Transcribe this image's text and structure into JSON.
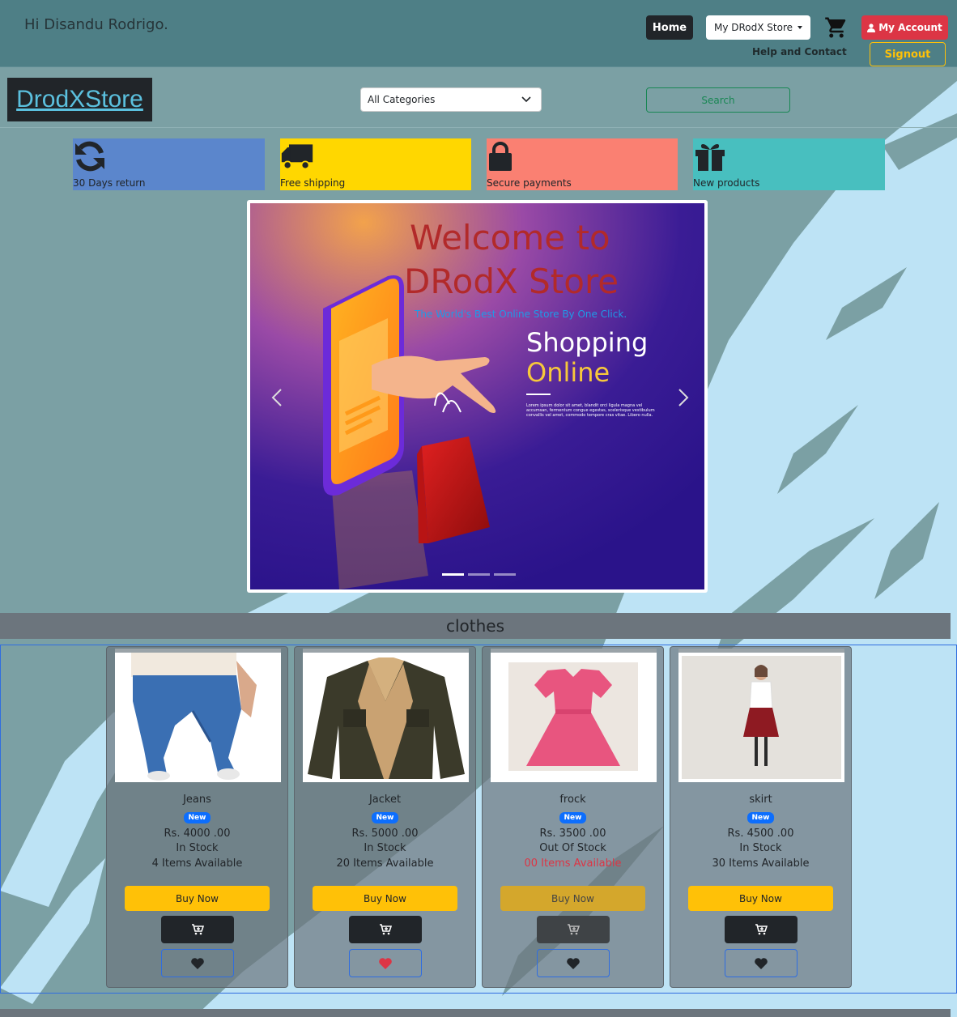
{
  "topbar": {
    "greeting": "Hi Disandu Rodrigo.",
    "home_label": "Home",
    "store_label": "My DRodX Store",
    "account_label": "My Account",
    "help_label": "Help and Contact",
    "signout_label": "Signout"
  },
  "header": {
    "logo": "DrodXStore",
    "category_selected": "All Categories",
    "search_label": "Search"
  },
  "features": [
    {
      "label": "30 Days return",
      "icon": "refresh-icon",
      "color": "#5b86cc"
    },
    {
      "label": "Free shipping",
      "icon": "truck-icon",
      "color": "#ffd700"
    },
    {
      "label": "Secure payments",
      "icon": "lock-icon",
      "color": "#fa8072"
    },
    {
      "label": "New products",
      "icon": "gift-icon",
      "color": "#48bfbf"
    }
  ],
  "carousel": {
    "title_line1": "Welcome to",
    "title_line2": "DRodX Store",
    "subtitle": "The World's Best Online Store By One Click.",
    "shopping": "Shopping",
    "online": "Online",
    "lorem": "Lorem ipsum dolor sit amet, blandit orci ligula magna vel accumsan, fermentum congue egestas, scelerisque vestibulum convallis vel amet, commodo tempore cras vitae. Libero nulla.",
    "active_slide": 1,
    "slide_count": 3
  },
  "section": {
    "title": "clothes"
  },
  "products": [
    {
      "name": "Jeans",
      "badge": "New",
      "price": "Rs. 4000 .00",
      "stock": "In Stock",
      "available": "4 Items Available",
      "buy_label": "Buy Now",
      "favorited": false
    },
    {
      "name": "Jacket",
      "badge": "New",
      "price": "Rs. 5000 .00",
      "stock": "In Stock",
      "available": "20 Items Available",
      "buy_label": "Buy Now",
      "favorited": true
    },
    {
      "name": "frock",
      "badge": "New",
      "price": "Rs. 3500 .00",
      "stock": "Out Of Stock",
      "available": "00 Items Available",
      "buy_label": "Buy Now",
      "favorited": false
    },
    {
      "name": "skirt",
      "badge": "New",
      "price": "Rs. 4500 .00",
      "stock": "In Stock",
      "available": "30 Items Available",
      "buy_label": "Buy Now",
      "favorited": false
    }
  ],
  "colors": {
    "accent_danger": "#dc3545",
    "accent_warning": "#ffc107",
    "accent_primary": "#0d6efd",
    "accent_success": "#198754"
  }
}
